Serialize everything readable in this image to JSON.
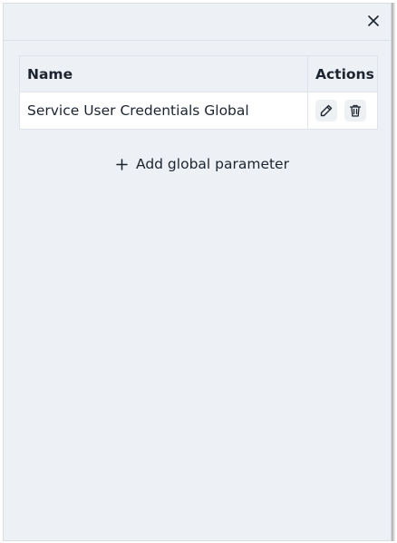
{
  "header": {
    "close_icon": "close-icon"
  },
  "table": {
    "columns": [
      "Name",
      "Actions"
    ],
    "rows": [
      {
        "name": "Service User Credentials Global",
        "actions": [
          "edit-icon",
          "trash-icon"
        ]
      }
    ]
  },
  "add_button": {
    "label": "Add global parameter",
    "icon": "plus-icon"
  }
}
